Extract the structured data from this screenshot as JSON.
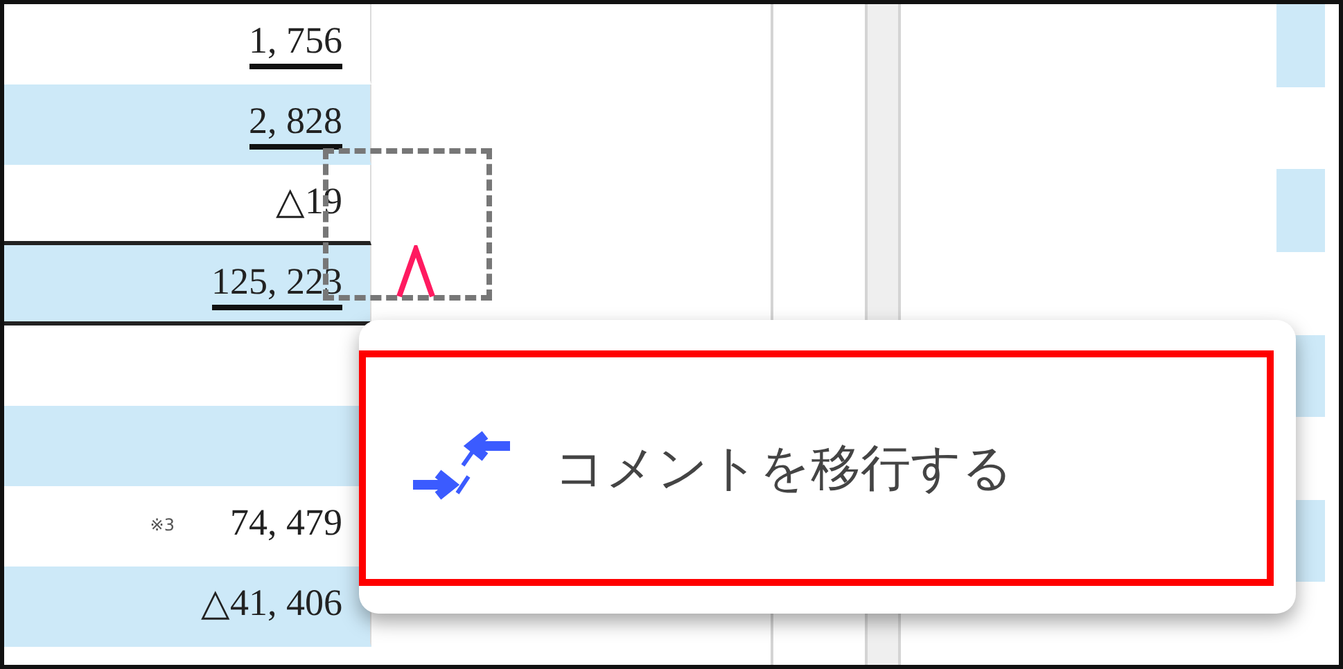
{
  "table": {
    "rows": [
      {
        "value": "1, 756",
        "shaded": false,
        "underlined": true,
        "ruled": false
      },
      {
        "value": "2, 828",
        "shaded": true,
        "underlined": true,
        "ruled": false
      },
      {
        "value": "△19",
        "shaded": false,
        "underlined": false,
        "ruled": true
      },
      {
        "value": "125, 223",
        "shaded": true,
        "underlined": true,
        "ruled": true
      },
      {
        "shaded": false,
        "ruled": false
      },
      {
        "shaded": true,
        "ruled": false
      },
      {
        "value": "74, 479",
        "note": "※3",
        "shaded": false,
        "underlined": false,
        "ruled": false
      },
      {
        "value": "△41, 406",
        "shaded": true,
        "underlined": false,
        "ruled": false
      }
    ]
  },
  "context_menu": {
    "items": [
      {
        "label": "コメントを移行する",
        "highlighted": true
      }
    ]
  }
}
